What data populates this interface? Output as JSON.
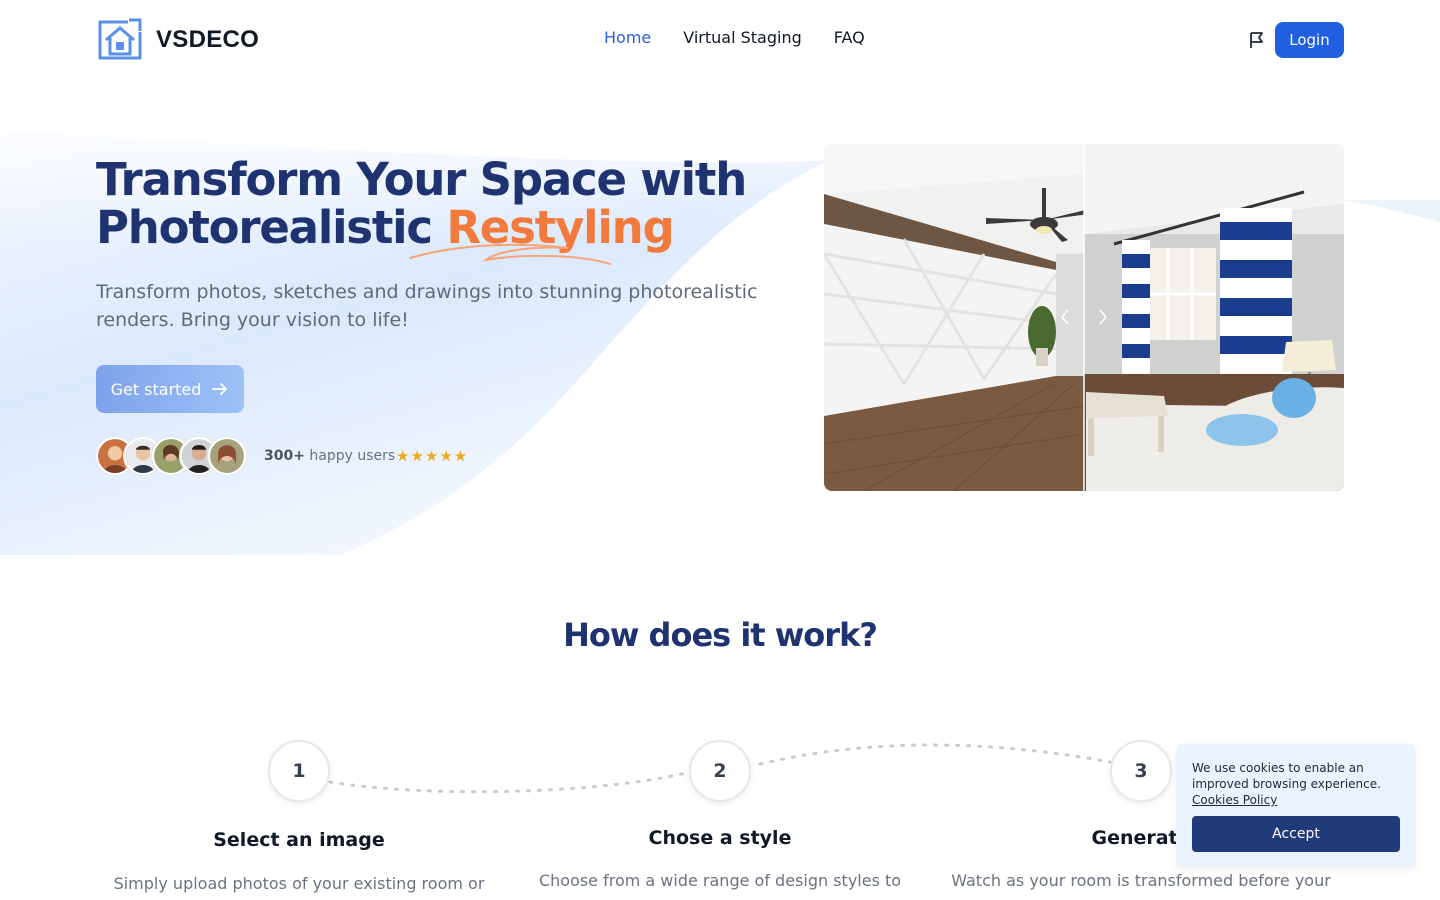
{
  "nav": {
    "brand": "VSDECO",
    "links": [
      {
        "label": "Home",
        "active": true
      },
      {
        "label": "Virtual Staging",
        "active": false
      },
      {
        "label": "FAQ",
        "active": false
      }
    ],
    "login_label": "Login"
  },
  "hero": {
    "title_line1": "Transform Your Space with",
    "title_line2": "Photorealistic",
    "title_accent": "Restyling",
    "subtitle": "Transform photos, sketches and drawings into stunning photorealistic renders. Bring your vision to life!",
    "cta_label": "Get started",
    "users_count": "300+",
    "users_label": "happy users",
    "stars": "★★★★★",
    "rating": 5
  },
  "how": {
    "title": "How does it work?",
    "steps": [
      {
        "number": "1",
        "title": "Select an image",
        "desc": "Simply upload photos of your existing room or"
      },
      {
        "number": "2",
        "title": "Chose a style",
        "desc": "Choose from a wide range of design styles to"
      },
      {
        "number": "3",
        "title": "Generate",
        "desc": "Watch as your room is transformed before your"
      }
    ]
  },
  "cookie": {
    "text": "We use cookies to enable an improved browsing experience.",
    "link": "Cookies Policy",
    "accept_label": "Accept"
  },
  "colors": {
    "brand_blue": "#1f5fe0",
    "title_navy": "#1e3370",
    "accent_orange": "#f27a3d",
    "star_gold": "#f0a81c"
  }
}
